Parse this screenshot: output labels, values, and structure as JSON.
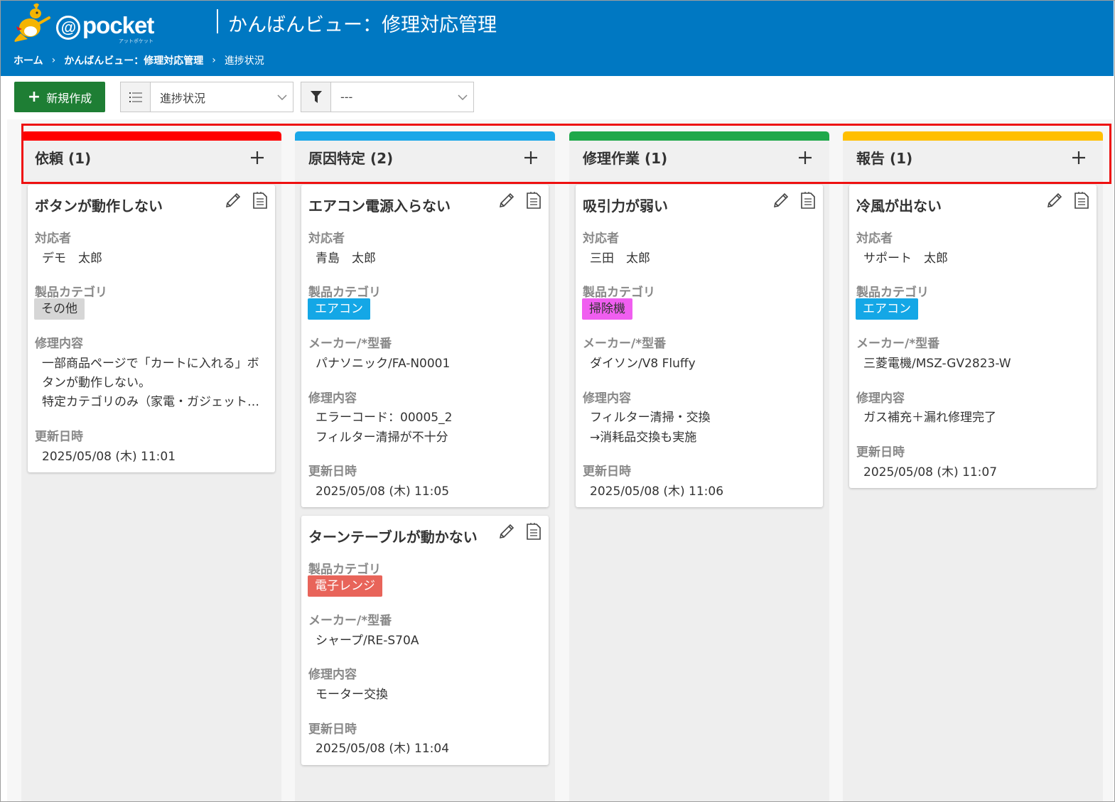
{
  "header": {
    "logo_text": "pocket",
    "logo_at": "@",
    "logo_sub": "アットポケット",
    "title": "かんばんビュー：修理対応管理",
    "breadcrumb": [
      "ホーム",
      "かんばんビュー：修理対応管理",
      "進捗状況"
    ],
    "breadcrumb_sep": "›",
    "bg_color": "#0078c2"
  },
  "toolbar": {
    "new_label": "新規作成",
    "group_value": "進捗状況",
    "filter_value": "---",
    "new_color": "#1e7e34"
  },
  "columns": [
    {
      "title": "依頼 (1)",
      "color": "#ff0000",
      "cards": [
        {
          "title": "ボタンが動作しない",
          "assignee_label": "対応者",
          "assignee": "デモ　太郎",
          "category_label": "製品カテゴリ",
          "category": "その他",
          "category_bg": "#d6d6d6",
          "category_fg": "#333333",
          "repair_label": "修理内容",
          "repair": [
            "一部商品ページで「カートに入れる」ボ",
            "タンが動作しない。",
            "特定カテゴリのみ（家電・ガジェット…"
          ],
          "updated_label": "更新日時",
          "updated": "2025/05/08 (木) 11:01"
        }
      ]
    },
    {
      "title": "原因特定 (2)",
      "color": "#1aa7e8",
      "cards": [
        {
          "title": "エアコン電源入らない",
          "assignee_label": "対応者",
          "assignee": "青島　太郎",
          "category_label": "製品カテゴリ",
          "category": "エアコン",
          "category_bg": "#14a7e6",
          "category_fg": "#ffffff",
          "maker_label": "メーカー/*型番",
          "maker": "パナソニック/FA-N0001",
          "repair_label": "修理内容",
          "repair": [
            "エラーコード：00005_2",
            "フィルター清掃が不十分"
          ],
          "updated_label": "更新日時",
          "updated": "2025/05/08 (木) 11:05"
        },
        {
          "title": "ターンテーブルが動かない",
          "category_label": "製品カテゴリ",
          "category": "電子レンジ",
          "category_bg": "#e8645a",
          "category_fg": "#ffffff",
          "maker_label": "メーカー/*型番",
          "maker": "シャープ/RE-S70A",
          "repair_label": "修理内容",
          "repair": [
            "モーター交換"
          ],
          "updated_label": "更新日時",
          "updated": "2025/05/08 (木) 11:04"
        }
      ]
    },
    {
      "title": "修理作業 (1)",
      "color": "#1fa84a",
      "cards": [
        {
          "title": "吸引力が弱い",
          "assignee_label": "対応者",
          "assignee": "三田　太郎",
          "category_label": "製品カテゴリ",
          "category": "掃除機",
          "category_bg": "#f05ef0",
          "category_fg": "#333333",
          "maker_label": "メーカー/*型番",
          "maker": "ダイソン/V8 Fluffy",
          "repair_label": "修理内容",
          "repair": [
            "フィルター清掃・交換",
            "→消耗品交換も実施"
          ],
          "updated_label": "更新日時",
          "updated": "2025/05/08 (木) 11:06"
        }
      ]
    },
    {
      "title": "報告 (1)",
      "color": "#ffbf00",
      "cards": [
        {
          "title": "冷風が出ない",
          "assignee_label": "対応者",
          "assignee": "サポート　太郎",
          "category_label": "製品カテゴリ",
          "category": "エアコン",
          "category_bg": "#14a7e6",
          "category_fg": "#ffffff",
          "maker_label": "メーカー/*型番",
          "maker": "三菱電機/MSZ-GV2823-W",
          "repair_label": "修理内容",
          "repair": [
            "ガス補充＋漏れ修理完了"
          ],
          "updated_label": "更新日時",
          "updated": "2025/05/08 (木) 11:07"
        }
      ]
    }
  ]
}
